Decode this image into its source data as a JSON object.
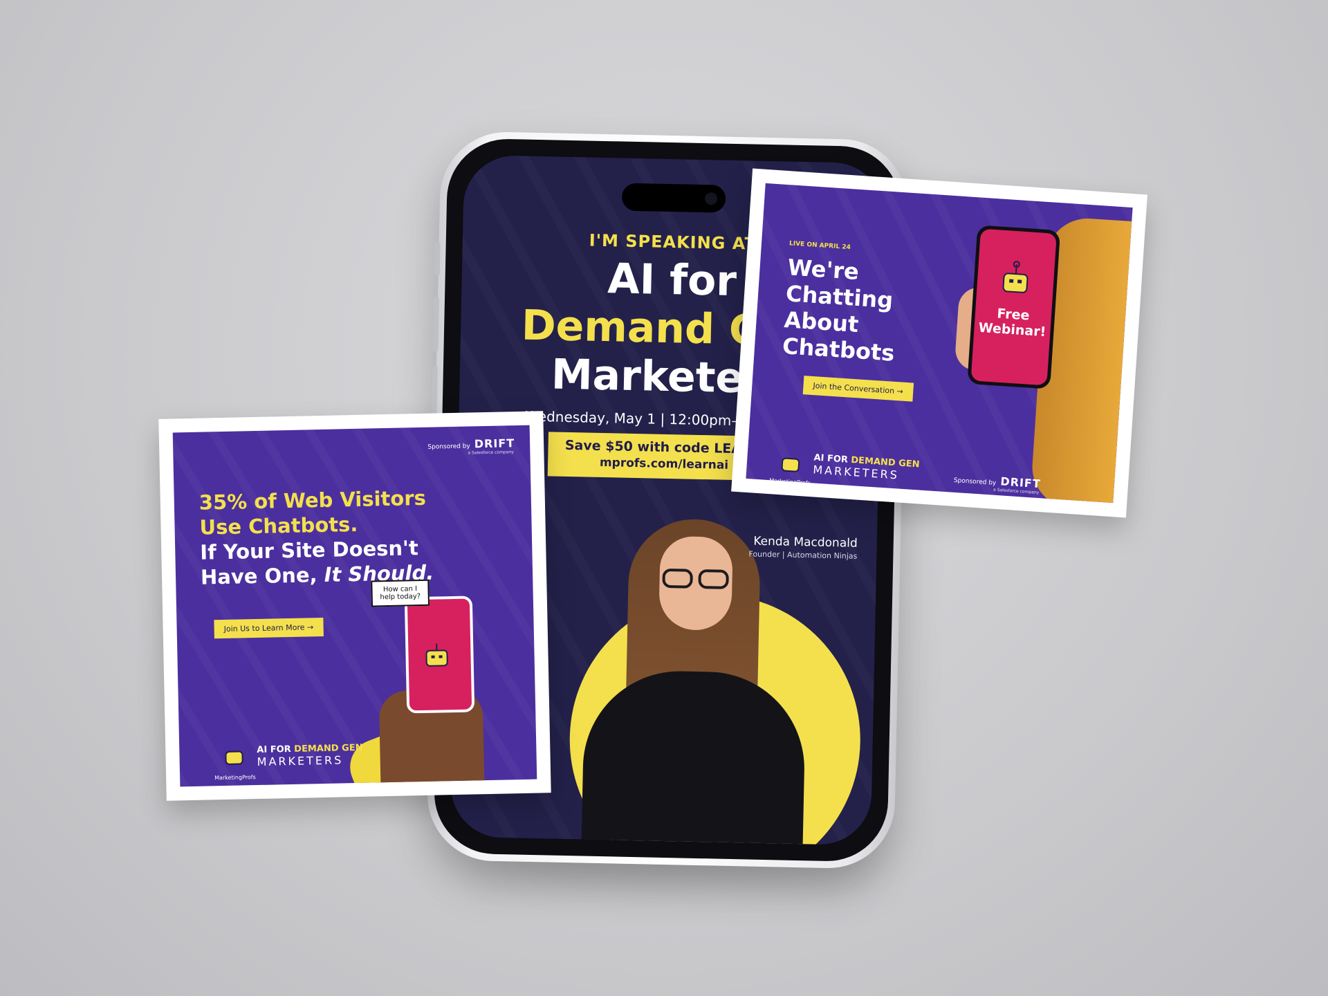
{
  "phone_ad": {
    "eyebrow": "I'M SPEAKING AT",
    "title_line1": "AI for",
    "title_line2": "Demand Gen",
    "title_line3": "Marketers",
    "date": "Wednesday, May 1  |  12:00pm–1:00pm ET",
    "promo_line1": "Save $50 with code LEARNAI",
    "promo_line2": "mprofs.com/learnai →",
    "speaker_name": "Kenda Macdonald",
    "speaker_role": "Founder | Automation Ninjas"
  },
  "left_ad": {
    "sponsor_label": "Sponsored by",
    "sponsor_brand": "DRIFT",
    "sponsor_sub": "a Salesforce company",
    "headline_y1": "35% of Web Visitors",
    "headline_y2": "Use Chatbots.",
    "headline_w1": "If Your Site Doesn't",
    "headline_w2_a": "Have One, ",
    "headline_w2_b": "It Should.",
    "cta": "Join Us to Learn More →",
    "bubble": "How can I help today?",
    "brand_prefix": "AI FOR ",
    "brand_highlight": "DEMAND GEN",
    "brand_line2": "MARKETERS",
    "brand_publisher": "MarketingProfs"
  },
  "right_ad": {
    "live": "LIVE ON APRIL 24",
    "head1": "We're",
    "head2": "Chatting",
    "head3": "About",
    "head4": "Chatbots",
    "phone_text1": "Free",
    "phone_text2": "Webinar!",
    "cta": "Join the Conversation →",
    "sponsor_label": "Sponsored by",
    "sponsor_brand": "DRIFT",
    "sponsor_sub": "a Salesforce company",
    "brand_prefix": "AI FOR ",
    "brand_highlight": "DEMAND GEN",
    "brand_line2": "MARKETERS",
    "brand_publisher": "MarketingProfs"
  },
  "colors": {
    "purple": "#4b2f9e",
    "navy": "#23214a",
    "yellow": "#f4e04d",
    "pink": "#d6215e"
  }
}
